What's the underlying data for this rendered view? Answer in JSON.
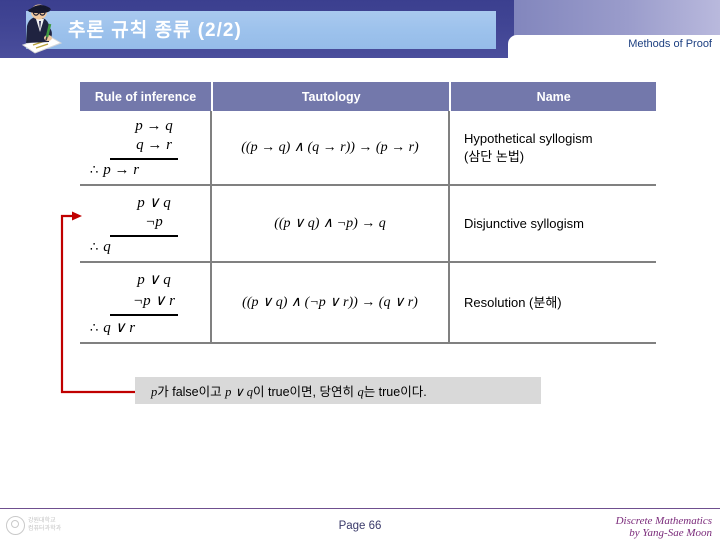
{
  "header": {
    "title": "추론 규칙 종류 (2/2)",
    "section_label": "Methods of Proof",
    "clipart_name": "writer-clipart",
    "plate_color": "#9dc2ec",
    "navy_color": "#414594",
    "purple_color": "#9a9ccb"
  },
  "table": {
    "columns": [
      "Rule of inference",
      "Tautology",
      "Name"
    ],
    "header_bg": "#7378ab",
    "rows": [
      {
        "premise1": "p → q",
        "premise2": "q → r",
        "therefore": "∴",
        "conclusion": "p → r",
        "tautology": "((p → q) ∧ (q → r)) → (p → r)",
        "name_line1": "Hypothetical syllogism",
        "name_line2": "(삼단 논법)"
      },
      {
        "premise1": "p ∨ q",
        "premise2": "¬p",
        "therefore": "∴",
        "conclusion": "q",
        "tautology": "((p ∨ q) ∧ ¬p) → q",
        "name_line1": "Disjunctive syllogism",
        "name_line2": ""
      },
      {
        "premise1": "p ∨ q",
        "premise2": "¬p ∨ r",
        "therefore": "∴",
        "conclusion": "q ∨ r",
        "tautology": "((p ∨ q) ∧ (¬p ∨ r)) → (q ∨ r)",
        "name_line1": "Resolution (분해)",
        "name_line2": ""
      }
    ]
  },
  "annotation": {
    "color": "#c00000",
    "target_row_index": 1,
    "description": "red elbow connector from disjunctive-syllogism row to callout"
  },
  "callout": {
    "text_part1": "p",
    "text_part2": "가 false이고 ",
    "text_part3": "p ∨ q",
    "text_part4": "이 true이면, 당연히 ",
    "text_part5": "q",
    "text_part6": "는 true이다.",
    "full_text": "p가 false이고 p ∨ q이 true이면, 당연히 q는 true이다.",
    "bg_color": "#d9d9d9"
  },
  "footer": {
    "page_label": "Page 66",
    "credit_line1": "Discrete Mathematics",
    "credit_line2": "by Yang-Sae Moon",
    "logo_line1": "강원대학교",
    "logo_line2": "컴퓨터과학과",
    "credit_color": "#7a2a7a"
  }
}
